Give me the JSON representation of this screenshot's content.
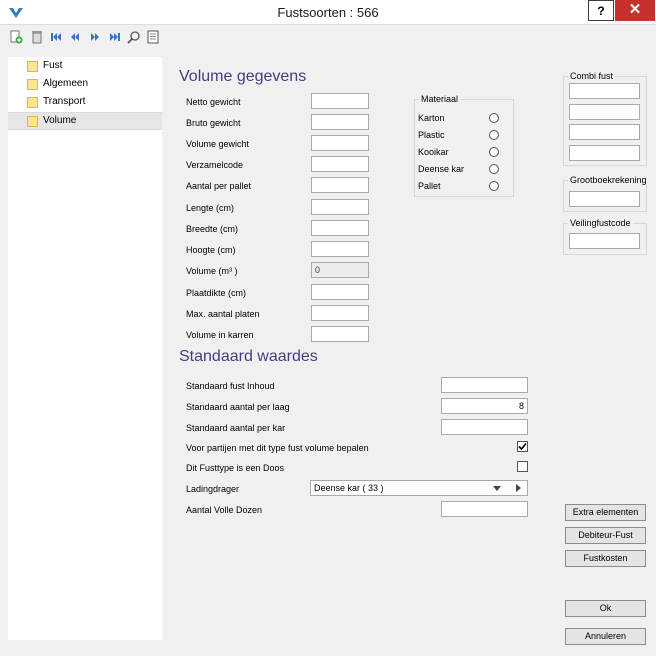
{
  "window": {
    "title": "Fustsoorten : 566",
    "help_label": "?",
    "close_label": "✕"
  },
  "toolbar": {
    "icons": [
      "add-icon",
      "delete-icon",
      "first-icon",
      "previous-icon",
      "next-icon",
      "last-icon",
      "search-icon",
      "note-icon"
    ]
  },
  "tree": {
    "items": [
      {
        "label": "Fust",
        "selected": false
      },
      {
        "label": "Algemeen",
        "selected": false
      },
      {
        "label": "Transport",
        "selected": false
      },
      {
        "label": "Volume",
        "selected": true
      }
    ]
  },
  "volume": {
    "title": "Volume gegevens",
    "fields": [
      {
        "label": "Netto gewicht",
        "value": ""
      },
      {
        "label": "Bruto gewicht",
        "value": ""
      },
      {
        "label": "Volume gewicht",
        "value": ""
      },
      {
        "label": "Verzamelcode",
        "value": ""
      },
      {
        "label": "Aantal per pallet",
        "value": ""
      },
      {
        "label": "Lengte (cm)",
        "value": ""
      },
      {
        "label": "Breedte (cm)",
        "value": ""
      },
      {
        "label": "Hoogte (cm)",
        "value": ""
      },
      {
        "label": "Volume (m³ )",
        "value": "0"
      },
      {
        "label": "Plaatdikte (cm)",
        "value": ""
      },
      {
        "label": "Max. aantal platen",
        "value": ""
      },
      {
        "label": "Volume in karren",
        "value": ""
      }
    ]
  },
  "materiaal": {
    "title": "Materiaal",
    "options": [
      "Karton",
      "Plastic",
      "Kooikar",
      "Deense kar",
      "Pallet"
    ]
  },
  "combi_fust": {
    "title": "Combi fust",
    "values": [
      "",
      "",
      "",
      ""
    ]
  },
  "grootboek": {
    "title": "Grootboekrekening",
    "value": ""
  },
  "veiling": {
    "title": "Veilingfustcode",
    "value": ""
  },
  "standaard": {
    "title": "Standaard waardes",
    "inhoud": {
      "label": "Standaard fust Inhoud",
      "value": ""
    },
    "per_laag": {
      "label": "Standaard aantal per laag",
      "value": "8"
    },
    "per_kar": {
      "label": "Standaard aantal per kar",
      "value": ""
    },
    "voor_partijen": {
      "label": "Voor partijen met dit type fust volume bepalen",
      "checked": true
    },
    "is_doos": {
      "label": "Dit Fusttype is een Doos",
      "checked": false
    },
    "ladingdrager": {
      "label": "Ladingdrager",
      "value": "Deense kar  ( 33 )"
    },
    "volle_dozen": {
      "label": "Aantal Volle Dozen",
      "value": ""
    }
  },
  "buttons": {
    "extra": "Extra elementen",
    "debiteur": "Debiteur-Fust",
    "fustkosten": "Fustkosten",
    "ok": "Ok",
    "annuleren": "Annuleren"
  },
  "colors": {
    "title_accent": "#473b82",
    "close_bg": "#c7312b",
    "logo": "#3a7fb8"
  }
}
